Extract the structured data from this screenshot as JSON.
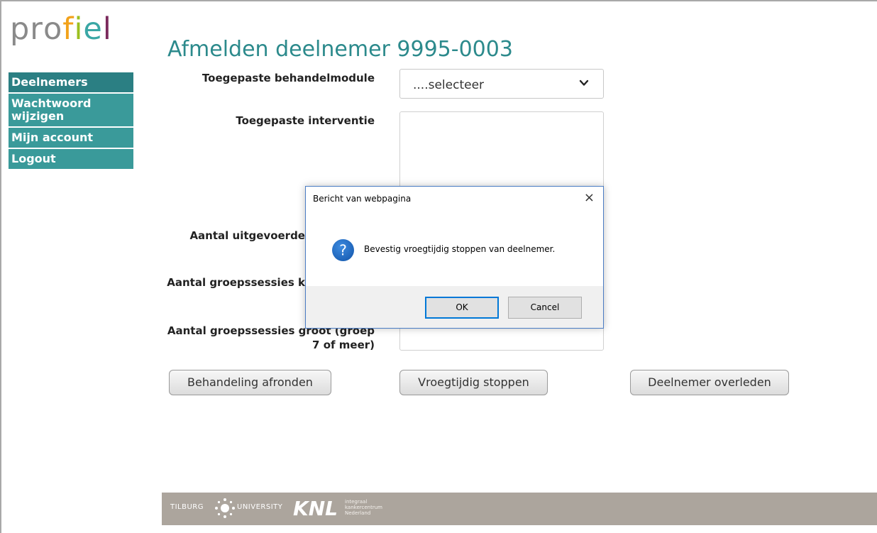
{
  "logo": {
    "letters": [
      {
        "ch": "p",
        "color": "#8a8a8a"
      },
      {
        "ch": "r",
        "color": "#8a8a8a"
      },
      {
        "ch": "o",
        "color": "#8a8a8a"
      },
      {
        "ch": "f",
        "color": "#f2a21b"
      },
      {
        "ch": "i",
        "color": "#9bbf1f"
      },
      {
        "ch": "e",
        "color": "#3aa7a5"
      },
      {
        "ch": "l",
        "color": "#7b2a5c"
      }
    ]
  },
  "sidebar": {
    "items": [
      {
        "label": "Deelnemers",
        "active": true
      },
      {
        "label": "Wachtwoord wijzigen",
        "active": false
      },
      {
        "label": "Mijn account",
        "active": false
      },
      {
        "label": "Logout",
        "active": false
      }
    ]
  },
  "page": {
    "title": "Afmelden deelnemer 9995-0003"
  },
  "form": {
    "module_label": "Toegepaste behandelmodule",
    "module_value": "....selecteer",
    "intervention_label": "Toegepaste interventie",
    "aantal_uitgevoerde_label": "Aantal uitgevoerde",
    "aantal_klein_label": "Aantal groepssessies k",
    "aantal_groot_label_line1": "Aantal groepssessies groot (groep",
    "aantal_groot_label_line2": "7 of meer)"
  },
  "actions": {
    "afronden": "Behandeling afronden",
    "stoppen": "Vroegtijdig stoppen",
    "overleden": "Deelnemer overleden"
  },
  "dialog": {
    "title": "Bericht van webpagina",
    "close": "×",
    "message": "Bevestig vroegtijdig stoppen van deelnemer.",
    "ok": "OK",
    "cancel": "Cancel"
  },
  "footer": {
    "tilburg": "TILBURG",
    "university": "UNIVERSITY",
    "knl": "KNL",
    "knl_sub1": "integraal",
    "knl_sub2": "kankercentrum",
    "knl_sub3": "Nederland"
  },
  "colors": {
    "nav": "#3a9a9a",
    "nav_active": "#2b7f83",
    "title": "#2c8a8c",
    "footer": "#aca59d",
    "dialog_border": "#4a7cc4",
    "ok_focus": "#0078d7"
  }
}
